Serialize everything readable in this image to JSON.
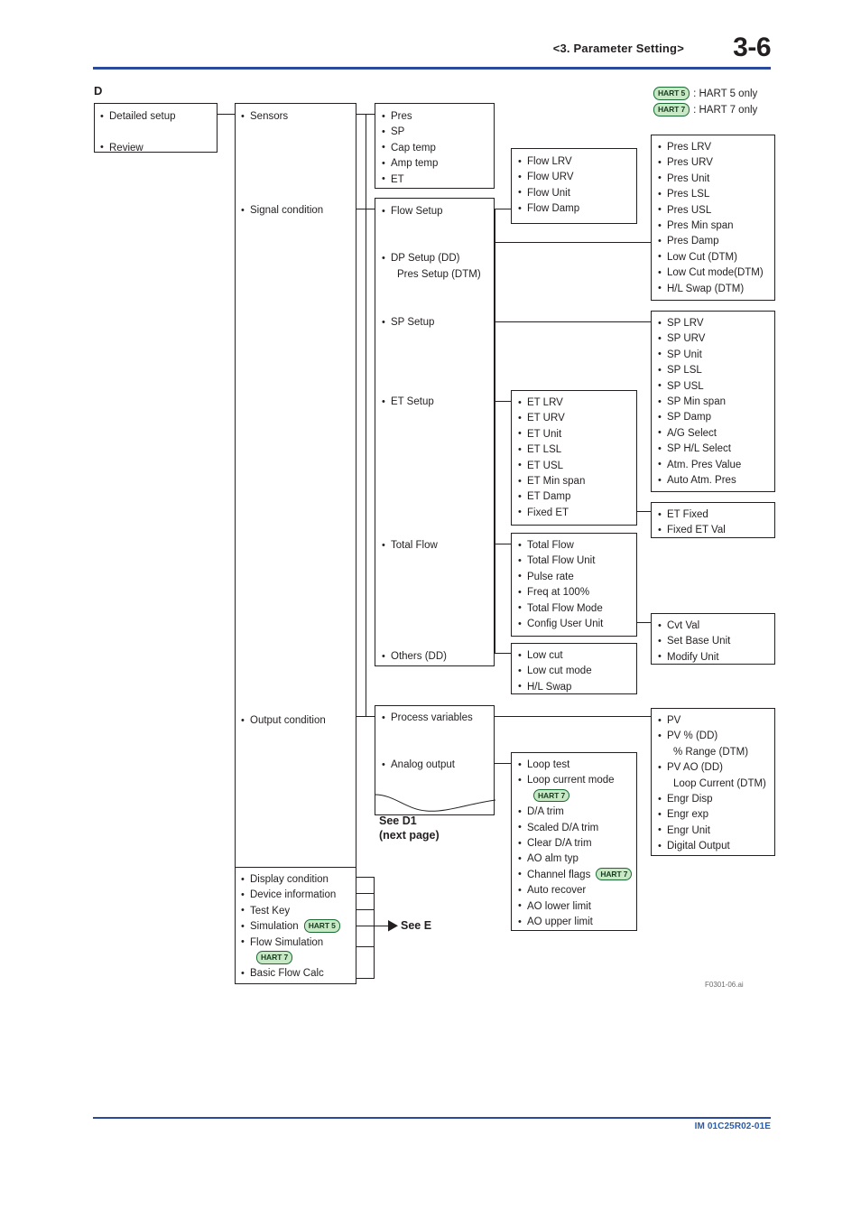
{
  "header": {
    "section": "<3.  Parameter Setting>",
    "page": "3-6"
  },
  "footer": {
    "doc_code": "IM 01C25R02-01E",
    "figure_id": "F0301-06.ai"
  },
  "diagram": {
    "section_letter": "D",
    "legend": [
      {
        "badge": "HART 5",
        "text": ": HART 5 only"
      },
      {
        "badge": "HART 7",
        "text": ": HART 7 only"
      }
    ],
    "pointers": {
      "see_d1_line1": "See D1",
      "see_d1_line2": "(next page)",
      "see_e": "See E"
    },
    "col1": {
      "items": [
        "Detailed setup",
        "Review"
      ]
    },
    "col2": {
      "items": [
        "Sensors",
        "Signal condition",
        "Output condition"
      ]
    },
    "col2b": {
      "items": [
        "Display condition",
        "Device information",
        "Test Key",
        "Simulation",
        "Flow Simulation",
        "Basic Flow Calc"
      ],
      "simulation_badge": "HART 5",
      "flow_simulation_badge": "HART 7"
    },
    "sensors_box": {
      "items": [
        "Pres",
        "SP",
        "Cap temp",
        "Amp temp",
        "ET"
      ]
    },
    "signal_box": {
      "items": [
        "Flow Setup",
        "DP Setup (DD)",
        "Pres Setup (DTM)",
        "SP Setup",
        "ET Setup",
        "Total Flow",
        "Others (DD)"
      ]
    },
    "flow_box": {
      "items": [
        "Flow LRV",
        "Flow URV",
        "Flow Unit",
        "Flow Damp"
      ]
    },
    "pres_box": {
      "items": [
        "Pres LRV",
        "Pres URV",
        "Pres Unit",
        "Pres LSL",
        "Pres USL",
        "Pres Min span",
        "Pres Damp",
        "Low Cut (DTM)",
        "Low Cut mode(DTM)",
        "H/L Swap (DTM)"
      ]
    },
    "sp_box": {
      "items": [
        "SP LRV",
        "SP URV",
        "SP Unit",
        "SP LSL",
        "SP USL",
        "SP Min span",
        "SP Damp",
        "A/G Select",
        "SP H/L Select",
        "Atm. Pres Value",
        "Auto Atm. Pres"
      ]
    },
    "et_box": {
      "items": [
        "ET LRV",
        "ET URV",
        "ET Unit",
        "ET LSL",
        "ET USL",
        "ET Min span",
        "ET Damp",
        "Fixed ET"
      ]
    },
    "etfixed_box": {
      "items": [
        "ET Fixed",
        "Fixed ET Val"
      ]
    },
    "totalflow_box": {
      "items": [
        "Total Flow",
        "Total Flow Unit",
        "Pulse rate",
        "Freq at 100%",
        "Total Flow Mode",
        "Config User Unit"
      ]
    },
    "cvt_box": {
      "items": [
        "Cvt Val",
        "Set Base Unit",
        "Modify Unit"
      ]
    },
    "others_box": {
      "items": [
        "Low cut",
        "Low cut mode",
        "H/L Swap"
      ]
    },
    "procvar_box": {
      "items": [
        "Process variables",
        "Analog output"
      ]
    },
    "pv_box": {
      "items": [
        "PV",
        "PV % (DD)",
        "% Range (DTM)",
        "PV AO (DD)",
        "Loop Current (DTM)",
        "Engr Disp",
        "Engr exp",
        "Engr Unit",
        "Digital Output"
      ]
    },
    "loop_box": {
      "items": [
        "Loop test",
        "Loop current mode",
        "D/A trim",
        "Scaled D/A trim",
        "Clear D/A trim",
        "AO alm typ",
        "Channel flags",
        "Auto recover",
        "AO lower limit",
        "AO upper limit"
      ],
      "loop_current_mode_badge": "HART 7",
      "channel_flags_badge": "HART 7"
    }
  }
}
